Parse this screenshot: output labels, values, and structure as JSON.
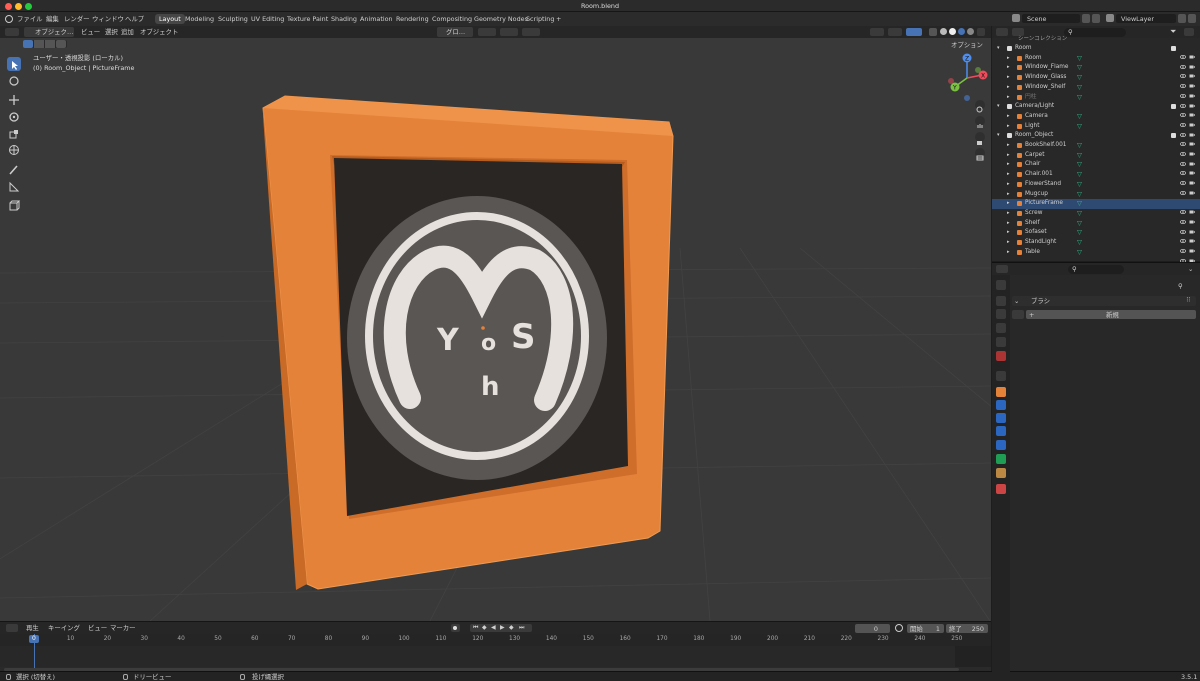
{
  "window": {
    "title": "Room.blend"
  },
  "menus": [
    "ファイル",
    "編集",
    "レンダー",
    "ウィンドウ",
    "ヘルプ"
  ],
  "workspaces": [
    {
      "label": "Layout",
      "active": true
    },
    {
      "label": "Modeling"
    },
    {
      "label": "Sculpting"
    },
    {
      "label": "UV Editing"
    },
    {
      "label": "Texture Paint"
    },
    {
      "label": "Shading"
    },
    {
      "label": "Animation"
    },
    {
      "label": "Rendering"
    },
    {
      "label": "Compositing"
    },
    {
      "label": "Geometry Nodes"
    },
    {
      "label": "Scripting"
    },
    {
      "label": "+"
    }
  ],
  "scene": {
    "name": "Scene",
    "view_layer": "ViewLayer"
  },
  "viewport": {
    "mode": "オブジェク…",
    "menus": [
      "ビュー",
      "選択",
      "追加",
      "オブジェクト"
    ],
    "orientation": "グロ…",
    "options": "オプション",
    "view_name": "ユーザー・透視投影 (ローカル)",
    "context": "(0) Room_Object | PictureFrame",
    "gizmo": {
      "x": "X",
      "y": "Y",
      "z": "Z"
    },
    "art_letters": {
      "y": "Y",
      "o": "o",
      "s": "S",
      "h": "h"
    }
  },
  "outliner": {
    "top_label": "シーンコレクション",
    "rows": [
      {
        "label": "Room",
        "type": "collection",
        "level": 0
      },
      {
        "label": "Room",
        "level": 1
      },
      {
        "label": "Window_Flame",
        "level": 1
      },
      {
        "label": "Window_Glass",
        "level": 1
      },
      {
        "label": "Window_Shelf",
        "level": 1
      },
      {
        "label": "円柱",
        "level": 1,
        "dim": true
      },
      {
        "label": "Camera/Light",
        "type": "collection",
        "level": 0
      },
      {
        "label": "Camera",
        "level": 1
      },
      {
        "label": "Light",
        "level": 1
      },
      {
        "label": "Room_Object",
        "type": "collection",
        "level": 0
      },
      {
        "label": "BookShelf.001",
        "level": 1
      },
      {
        "label": "Carpet",
        "level": 1
      },
      {
        "label": "Chair",
        "level": 1
      },
      {
        "label": "Chair.001",
        "level": 1
      },
      {
        "label": "FlowerStand",
        "level": 1
      },
      {
        "label": "Mugcup",
        "level": 1
      },
      {
        "label": "PictureFrame",
        "level": 1,
        "selected": true
      },
      {
        "label": "Screw",
        "level": 1
      },
      {
        "label": "Shelf",
        "level": 1
      },
      {
        "label": "Sofaset",
        "level": 1
      },
      {
        "label": "StandLight",
        "level": 1
      },
      {
        "label": "Table",
        "level": 1
      }
    ]
  },
  "properties": {
    "section": "ブラシ",
    "new_button": "新規"
  },
  "timeline": {
    "menus": [
      "再生",
      "キーイング",
      "ビュー",
      "マーカー"
    ],
    "current_frame": "0",
    "start_label": "開始",
    "start": "1",
    "end_label": "終了",
    "end": "250",
    "ticks": [
      "0",
      "10",
      "20",
      "30",
      "40",
      "50",
      "60",
      "70",
      "80",
      "90",
      "100",
      "110",
      "120",
      "130",
      "140",
      "150",
      "160",
      "170",
      "180",
      "190",
      "200",
      "210",
      "220",
      "230",
      "240",
      "250"
    ]
  },
  "status": {
    "select": "選択 (切替え)",
    "dolly": "ドリービュー",
    "lasso": "投げ縄選択",
    "version": "3.5.1"
  },
  "colors": {
    "accent": "#4772b3",
    "frame_orange": "#e5823a",
    "selected_row": "#2f4a72"
  }
}
